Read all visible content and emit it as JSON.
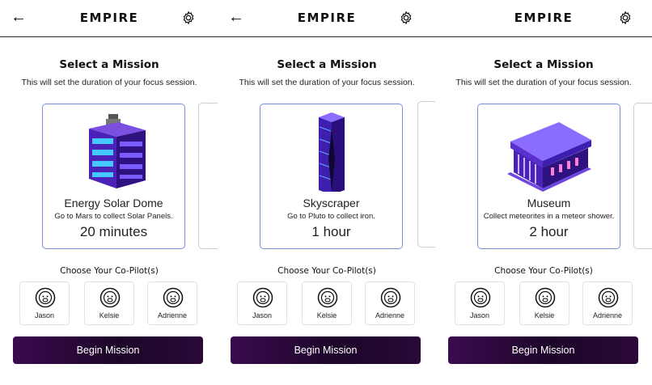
{
  "app": {
    "brand": "EMPIRE"
  },
  "icons": {
    "back": "left-arrow-icon",
    "settings": "gear-icon",
    "avatar": "astronaut-monkey-icon"
  },
  "colors": {
    "card_border": "#7b8fd6",
    "button_bg": "#1c0628",
    "illustration": "#5a2fd0"
  },
  "screens": [
    {
      "title": "Select a Mission",
      "subtitle": "This will set the duration of your focus session.",
      "mission": {
        "name": "Energy Solar Dome",
        "description": "Go to Mars to collect Solar Panels.",
        "duration": "20 minutes",
        "illustration": "solar-building"
      },
      "copilot_title": "Choose Your Co-Pilot(s)",
      "copilots": [
        "Jason",
        "Kelsie",
        "Adrienne"
      ],
      "button": "Begin Mission"
    },
    {
      "title": "Select a Mission",
      "subtitle": "This will set the duration of your focus session.",
      "mission": {
        "name": "Skyscraper",
        "description": "Go to Pluto to collect iron.",
        "duration": "1 hour",
        "illustration": "skyscraper"
      },
      "copilot_title": "Choose Your Co-Pilot(s)",
      "copilots": [
        "Jason",
        "Kelsie",
        "Adrienne"
      ],
      "button": "Begin Mission"
    },
    {
      "title": "Select a Mission",
      "subtitle": "This will set the duration of your focus session.",
      "mission": {
        "name": "Museum",
        "description": "Collect meteorites in a meteor shower.",
        "duration": "2 hour",
        "illustration": "museum"
      },
      "copilot_title": "Choose Your Co-Pilot(s)",
      "copilots": [
        "Jason",
        "Kelsie",
        "Adrienne"
      ],
      "button": "Begin Mission"
    }
  ]
}
